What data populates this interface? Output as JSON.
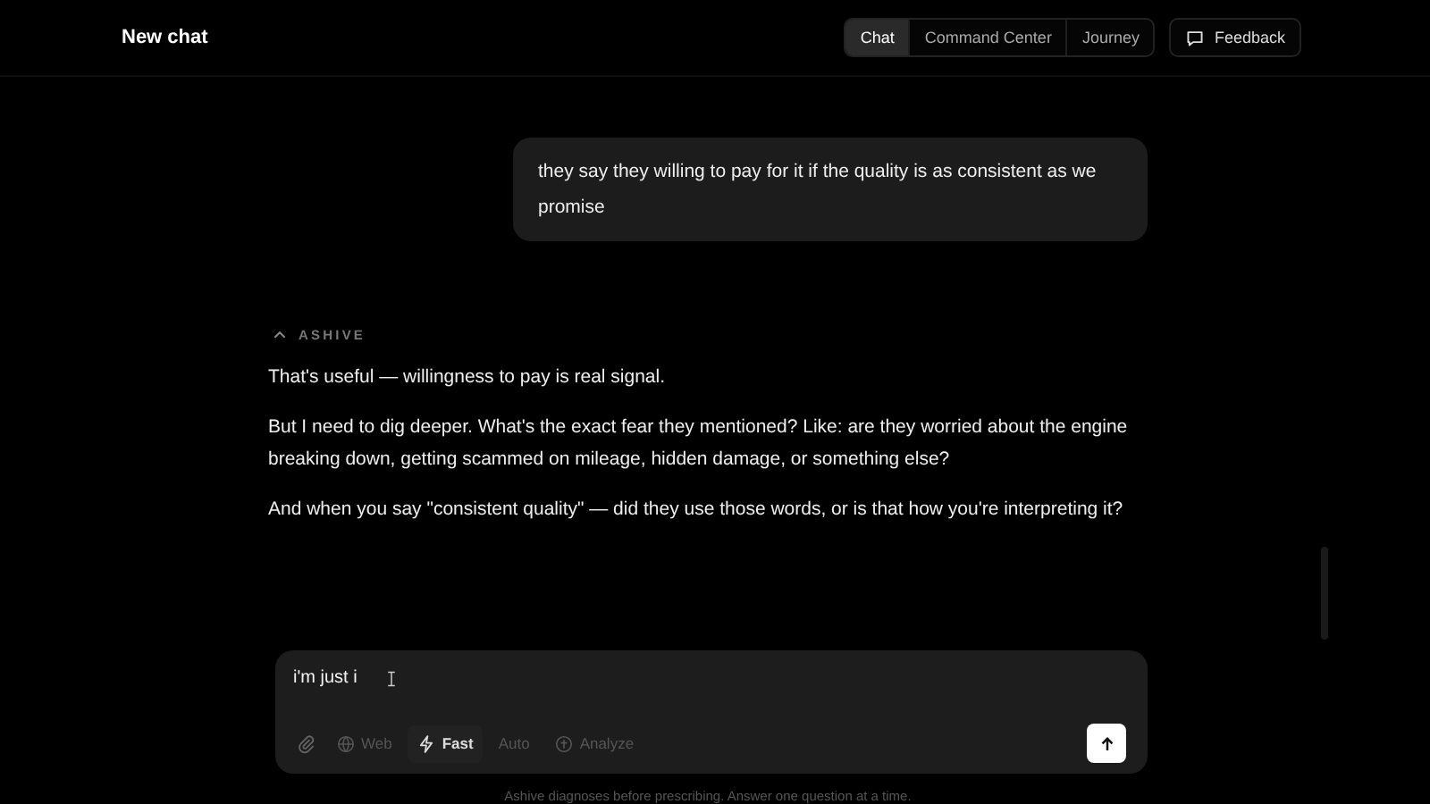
{
  "header": {
    "title": "New chat",
    "tabs": [
      {
        "label": "Chat",
        "selected": true
      },
      {
        "label": "Command Center",
        "selected": false
      },
      {
        "label": "Journey",
        "selected": false
      }
    ],
    "feedback": "Feedback"
  },
  "messages": [
    {
      "kind": "user",
      "text": "they say they willing to pay for it if the quality is as consistent as we promise"
    },
    {
      "kind": "assistant",
      "author": "ASHIVE",
      "paragraphs": [
        "That's useful — willingness to pay is real signal.",
        "But I need to dig deeper. What's the exact fear they mentioned? Like: are they worried about the engine breaking down, getting scammed on mileage, hidden damage, or something else?",
        "And when you say \"consistent quality\" — did they use those words, or is that how you're interpreting it?"
      ]
    }
  ],
  "composer": {
    "value": "i'm just i",
    "modes": [
      {
        "kind": "web",
        "label": "Web",
        "selected": false
      },
      {
        "kind": "fast",
        "label": "Fast",
        "selected": true
      },
      {
        "kind": "auto",
        "label": "Auto",
        "selected": false
      },
      {
        "kind": "analyze",
        "label": "Analyze",
        "selected": false
      }
    ]
  },
  "footer": "Ashive diagnoses before prescribing. Answer one question at a time."
}
